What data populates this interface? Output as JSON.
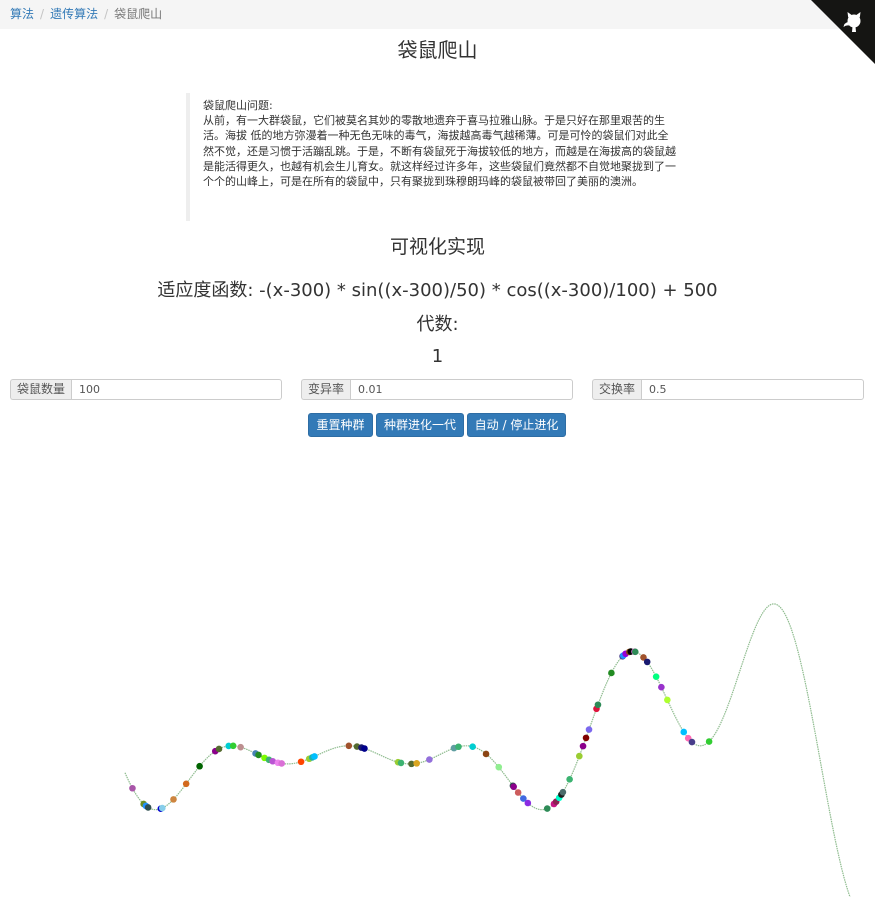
{
  "breadcrumb": {
    "items": [
      "算法",
      "遗传算法"
    ],
    "current": "袋鼠爬山"
  },
  "title": "袋鼠爬山",
  "intro": {
    "heading": "袋鼠爬山问题:",
    "body": "从前，有一大群袋鼠，它们被莫名其妙的零散地遗弃于喜马拉雅山脉。于是只好在那里艰苦的生活。海拔 低的地方弥漫着一种无色无味的毒气，海拔越高毒气越稀薄。可是可怜的袋鼠们对此全然不觉，还是习惯于活蹦乱跳。于是，不断有袋鼠死于海拔较低的地方，而越是在海拔高的袋鼠越是能活得更久，也越有机会生儿育女。就这样经过许多年，这些袋鼠们竟然都不自觉地聚拢到了一个个的山峰上，可是在所有的袋鼠中，只有聚拢到珠穆朗玛峰的袋鼠被带回了美丽的澳洲。"
  },
  "section_title": "可视化实现",
  "fitness_function": "适应度函数: -(x-300) * sin((x-300)/50) * cos((x-300)/100) + 500",
  "generation": {
    "label": "代数:",
    "value": "1"
  },
  "params": {
    "population": {
      "label": "袋鼠数量",
      "value": "100"
    },
    "mutation": {
      "label": "变异率",
      "value": "0.01"
    },
    "crossover": {
      "label": "交换率",
      "value": "0.5"
    }
  },
  "buttons": {
    "reset": "重置种群",
    "evolve": "种群进化一代",
    "auto": "自动 / 停止进化"
  },
  "colors": {
    "curve": "#8fbc8f",
    "button": "#337ab7",
    "link": "#337ab7"
  },
  "chart_data": {
    "type": "scatter",
    "function": "-(x-300) * sin((x-300)/50) * cos((x-300)/100) + 500",
    "xlim": [
      0,
      1000
    ],
    "ylim": [
      0,
      1400
    ],
    "curve_color": "#8fbc8f",
    "kangaroos": [
      {
        "x": 10,
        "color": "#a855a8"
      },
      {
        "x": 25,
        "color": "#6b8e23"
      },
      {
        "x": 28,
        "color": "#1e90ff"
      },
      {
        "x": 31,
        "color": "#2f4f4f"
      },
      {
        "x": 48,
        "color": "#0000cd"
      },
      {
        "x": 50,
        "color": "#87ceeb"
      },
      {
        "x": 65,
        "color": "#cd853f"
      },
      {
        "x": 82,
        "color": "#d2691e"
      },
      {
        "x": 100,
        "color": "#006400"
      },
      {
        "x": 121,
        "color": "#8b008b"
      },
      {
        "x": 126,
        "color": "#556b2f"
      },
      {
        "x": 139,
        "color": "#00ced1"
      },
      {
        "x": 145,
        "color": "#32cd32"
      },
      {
        "x": 155,
        "color": "#bc8f8f"
      },
      {
        "x": 175,
        "color": "#4682b4"
      },
      {
        "x": 179,
        "color": "#228b22"
      },
      {
        "x": 187,
        "color": "#7cfc00"
      },
      {
        "x": 193,
        "color": "#3cb371"
      },
      {
        "x": 198,
        "color": "#ba55d3"
      },
      {
        "x": 205,
        "color": "#ee82ee"
      },
      {
        "x": 210,
        "color": "#da70d6"
      },
      {
        "x": 236,
        "color": "#ff4500"
      },
      {
        "x": 247,
        "color": "#9acd32"
      },
      {
        "x": 251,
        "color": "#20b2aa"
      },
      {
        "x": 254,
        "color": "#00bfff"
      },
      {
        "x": 300,
        "color": "#a0522d"
      },
      {
        "x": 311,
        "color": "#556b2f"
      },
      {
        "x": 317,
        "color": "#191970"
      },
      {
        "x": 321,
        "color": "#00008b"
      },
      {
        "x": 366,
        "color": "#9acd32"
      },
      {
        "x": 370,
        "color": "#3cb371"
      },
      {
        "x": 384,
        "color": "#556b2f"
      },
      {
        "x": 391,
        "color": "#daa520"
      },
      {
        "x": 408,
        "color": "#9370db"
      },
      {
        "x": 441,
        "color": "#5f9ea0"
      },
      {
        "x": 447,
        "color": "#3cb371"
      },
      {
        "x": 466,
        "color": "#00ced1"
      },
      {
        "x": 484,
        "color": "#8b4513"
      },
      {
        "x": 501,
        "color": "#90ee90"
      },
      {
        "x": 520,
        "color": "#2f4f4f"
      },
      {
        "x": 521,
        "color": "#8b008b"
      },
      {
        "x": 527,
        "color": "#cd5c5c"
      },
      {
        "x": 534,
        "color": "#4169e1"
      },
      {
        "x": 540,
        "color": "#8a2be2"
      },
      {
        "x": 566,
        "color": "#2e8b57"
      },
      {
        "x": 575,
        "color": "#c71585"
      },
      {
        "x": 578,
        "color": "#8b2252"
      },
      {
        "x": 582,
        "color": "#00ffcc"
      },
      {
        "x": 585,
        "color": "#1e1e1e"
      },
      {
        "x": 587,
        "color": "#4b6b6b"
      },
      {
        "x": 596,
        "color": "#3cb371"
      },
      {
        "x": 609,
        "color": "#9acd32"
      },
      {
        "x": 614,
        "color": "#8b008b"
      },
      {
        "x": 618,
        "color": "#800000"
      },
      {
        "x": 622,
        "color": "#7b68ee"
      },
      {
        "x": 632,
        "color": "#dc143c"
      },
      {
        "x": 634,
        "color": "#2e8b57"
      },
      {
        "x": 652,
        "color": "#228b22"
      },
      {
        "x": 667,
        "color": "#483d8b"
      },
      {
        "x": 668,
        "color": "#1e90ff"
      },
      {
        "x": 671,
        "color": "#9400d3"
      },
      {
        "x": 676,
        "color": "#8b4513"
      },
      {
        "x": 678,
        "color": "#000000"
      },
      {
        "x": 683,
        "color": "#da70d6"
      },
      {
        "x": 684,
        "color": "#2e8b57"
      },
      {
        "x": 695,
        "color": "#a0522d"
      },
      {
        "x": 700,
        "color": "#191970"
      },
      {
        "x": 712,
        "color": "#00ff7f"
      },
      {
        "x": 719,
        "color": "#9932cc"
      },
      {
        "x": 727,
        "color": "#adff2f"
      },
      {
        "x": 749,
        "color": "#00bfff"
      },
      {
        "x": 755,
        "color": "#ff69b4"
      },
      {
        "x": 760,
        "color": "#483d8b"
      },
      {
        "x": 783,
        "color": "#32cd32"
      }
    ]
  }
}
